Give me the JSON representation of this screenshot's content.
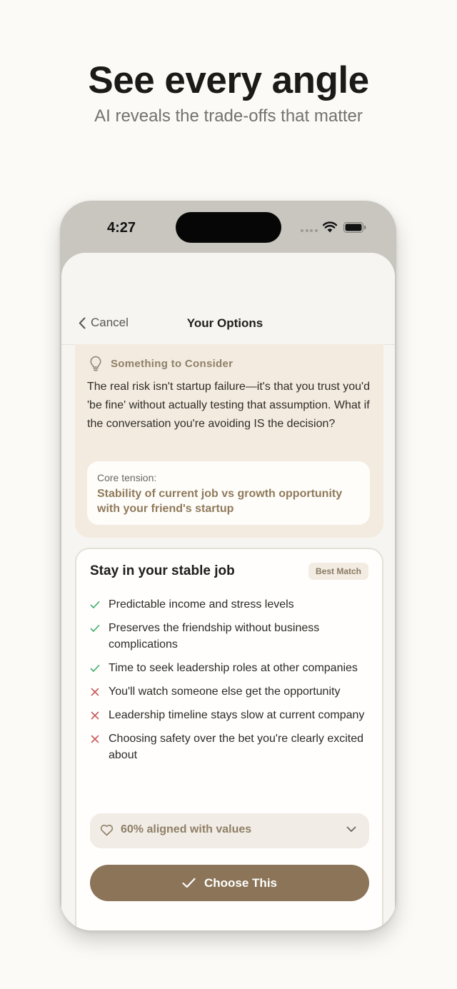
{
  "marketing": {
    "headline": "See every angle",
    "subheadline": "AI reveals the trade-offs that matter"
  },
  "status_bar": {
    "time": "4:27"
  },
  "nav": {
    "cancel_label": "Cancel",
    "title": "Your Options"
  },
  "consider": {
    "title": "Something to Consider",
    "body": "The real risk isn't startup failure—it's that you trust you'd 'be fine' without actually testing that assumption. What if the conversation you're avoiding IS the decision?",
    "tension_label": "Core tension:",
    "tension_text": "Stability of current job vs growth opportunity with your friend's startup"
  },
  "option": {
    "title": "Stay in your stable job",
    "badge": "Best Match",
    "points": [
      {
        "type": "pro",
        "text": "Predictable income and stress levels"
      },
      {
        "type": "pro",
        "text": "Preserves the friendship without business complications"
      },
      {
        "type": "pro",
        "text": "Time to seek leadership roles at other companies"
      },
      {
        "type": "con",
        "text": "You'll watch someone else get the opportunity"
      },
      {
        "type": "con",
        "text": "Leadership timeline stays slow at current company"
      },
      {
        "type": "con",
        "text": "Choosing safety over the bet you're clearly excited about"
      }
    ],
    "values_alignment": "60% aligned with values",
    "values_alignment_percent": 60,
    "choose_label": "Choose This"
  },
  "colors": {
    "accent": "#8b7457",
    "pro": "#3fae6b",
    "con": "#c75b5b",
    "background": "#fbfaf6"
  }
}
